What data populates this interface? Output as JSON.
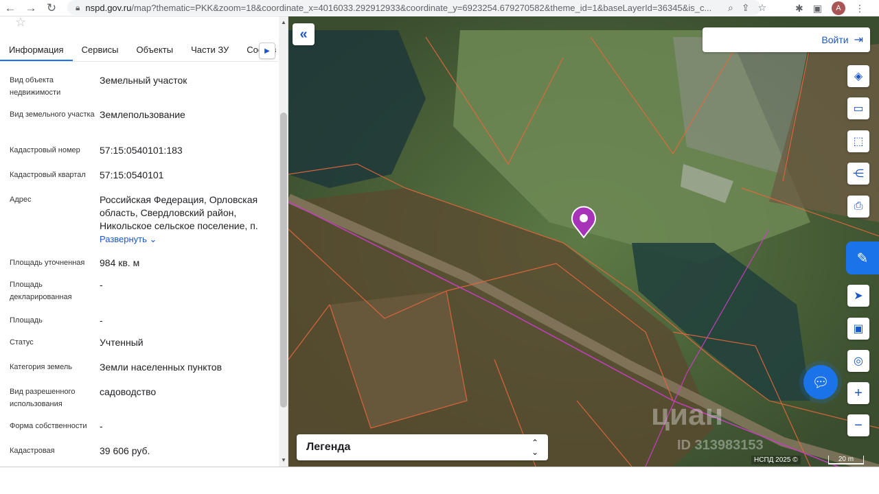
{
  "browser": {
    "url_domain": "nspd.gov.ru",
    "url_path": "/map?thematic=PKK&zoom=18&coordinate_x=4016033.292912933&coordinate_y=6923254.679270582&theme_id=1&baseLayerId=36345&is_c...",
    "avatar_letter": "A"
  },
  "panel": {
    "tabs": [
      {
        "label": "Информация"
      },
      {
        "label": "Сервисы"
      },
      {
        "label": "Объекты"
      },
      {
        "label": "Части ЗУ"
      },
      {
        "label": "Состав"
      }
    ],
    "rows": [
      {
        "label": "Вид объекта недвижимости",
        "value": "Земельный участок"
      },
      {
        "label": "Вид земельного участка",
        "value": "Землепользование"
      },
      {
        "label": "Кадастровый номер",
        "value": "57:15:0540101:183"
      },
      {
        "label": "Кадастровый квартал",
        "value": "57:15:0540101"
      },
      {
        "label": "Адрес",
        "value": "Российская Федерация, Орловская область, Свердловский район, Никольское сельское поселение, п."
      },
      {
        "label": "Площадь уточненная",
        "value": "984 кв. м"
      },
      {
        "label": "Площадь декларированная",
        "value": "-"
      },
      {
        "label": "Площадь",
        "value": "-"
      },
      {
        "label": "Статус",
        "value": "Учтенный"
      },
      {
        "label": "Категория земель",
        "value": "Земли населенных пунктов"
      },
      {
        "label": "Вид разрешенного использования",
        "value": "садоводство"
      },
      {
        "label": "Форма собственности",
        "value": "-"
      },
      {
        "label": "Кадастровая",
        "value": "39 606 руб."
      }
    ],
    "expand_label": "Развернуть"
  },
  "map": {
    "login_label": "Войти",
    "legend_label": "Легенда",
    "copyright": "НСПД 2025 ©",
    "scale_label": "20 m",
    "watermark": "циан",
    "watermark_id": "ID 313983153",
    "colors": {
      "accent": "#1a73e8",
      "parcel_line": "#e8673c",
      "marker": "#a733b8"
    }
  }
}
